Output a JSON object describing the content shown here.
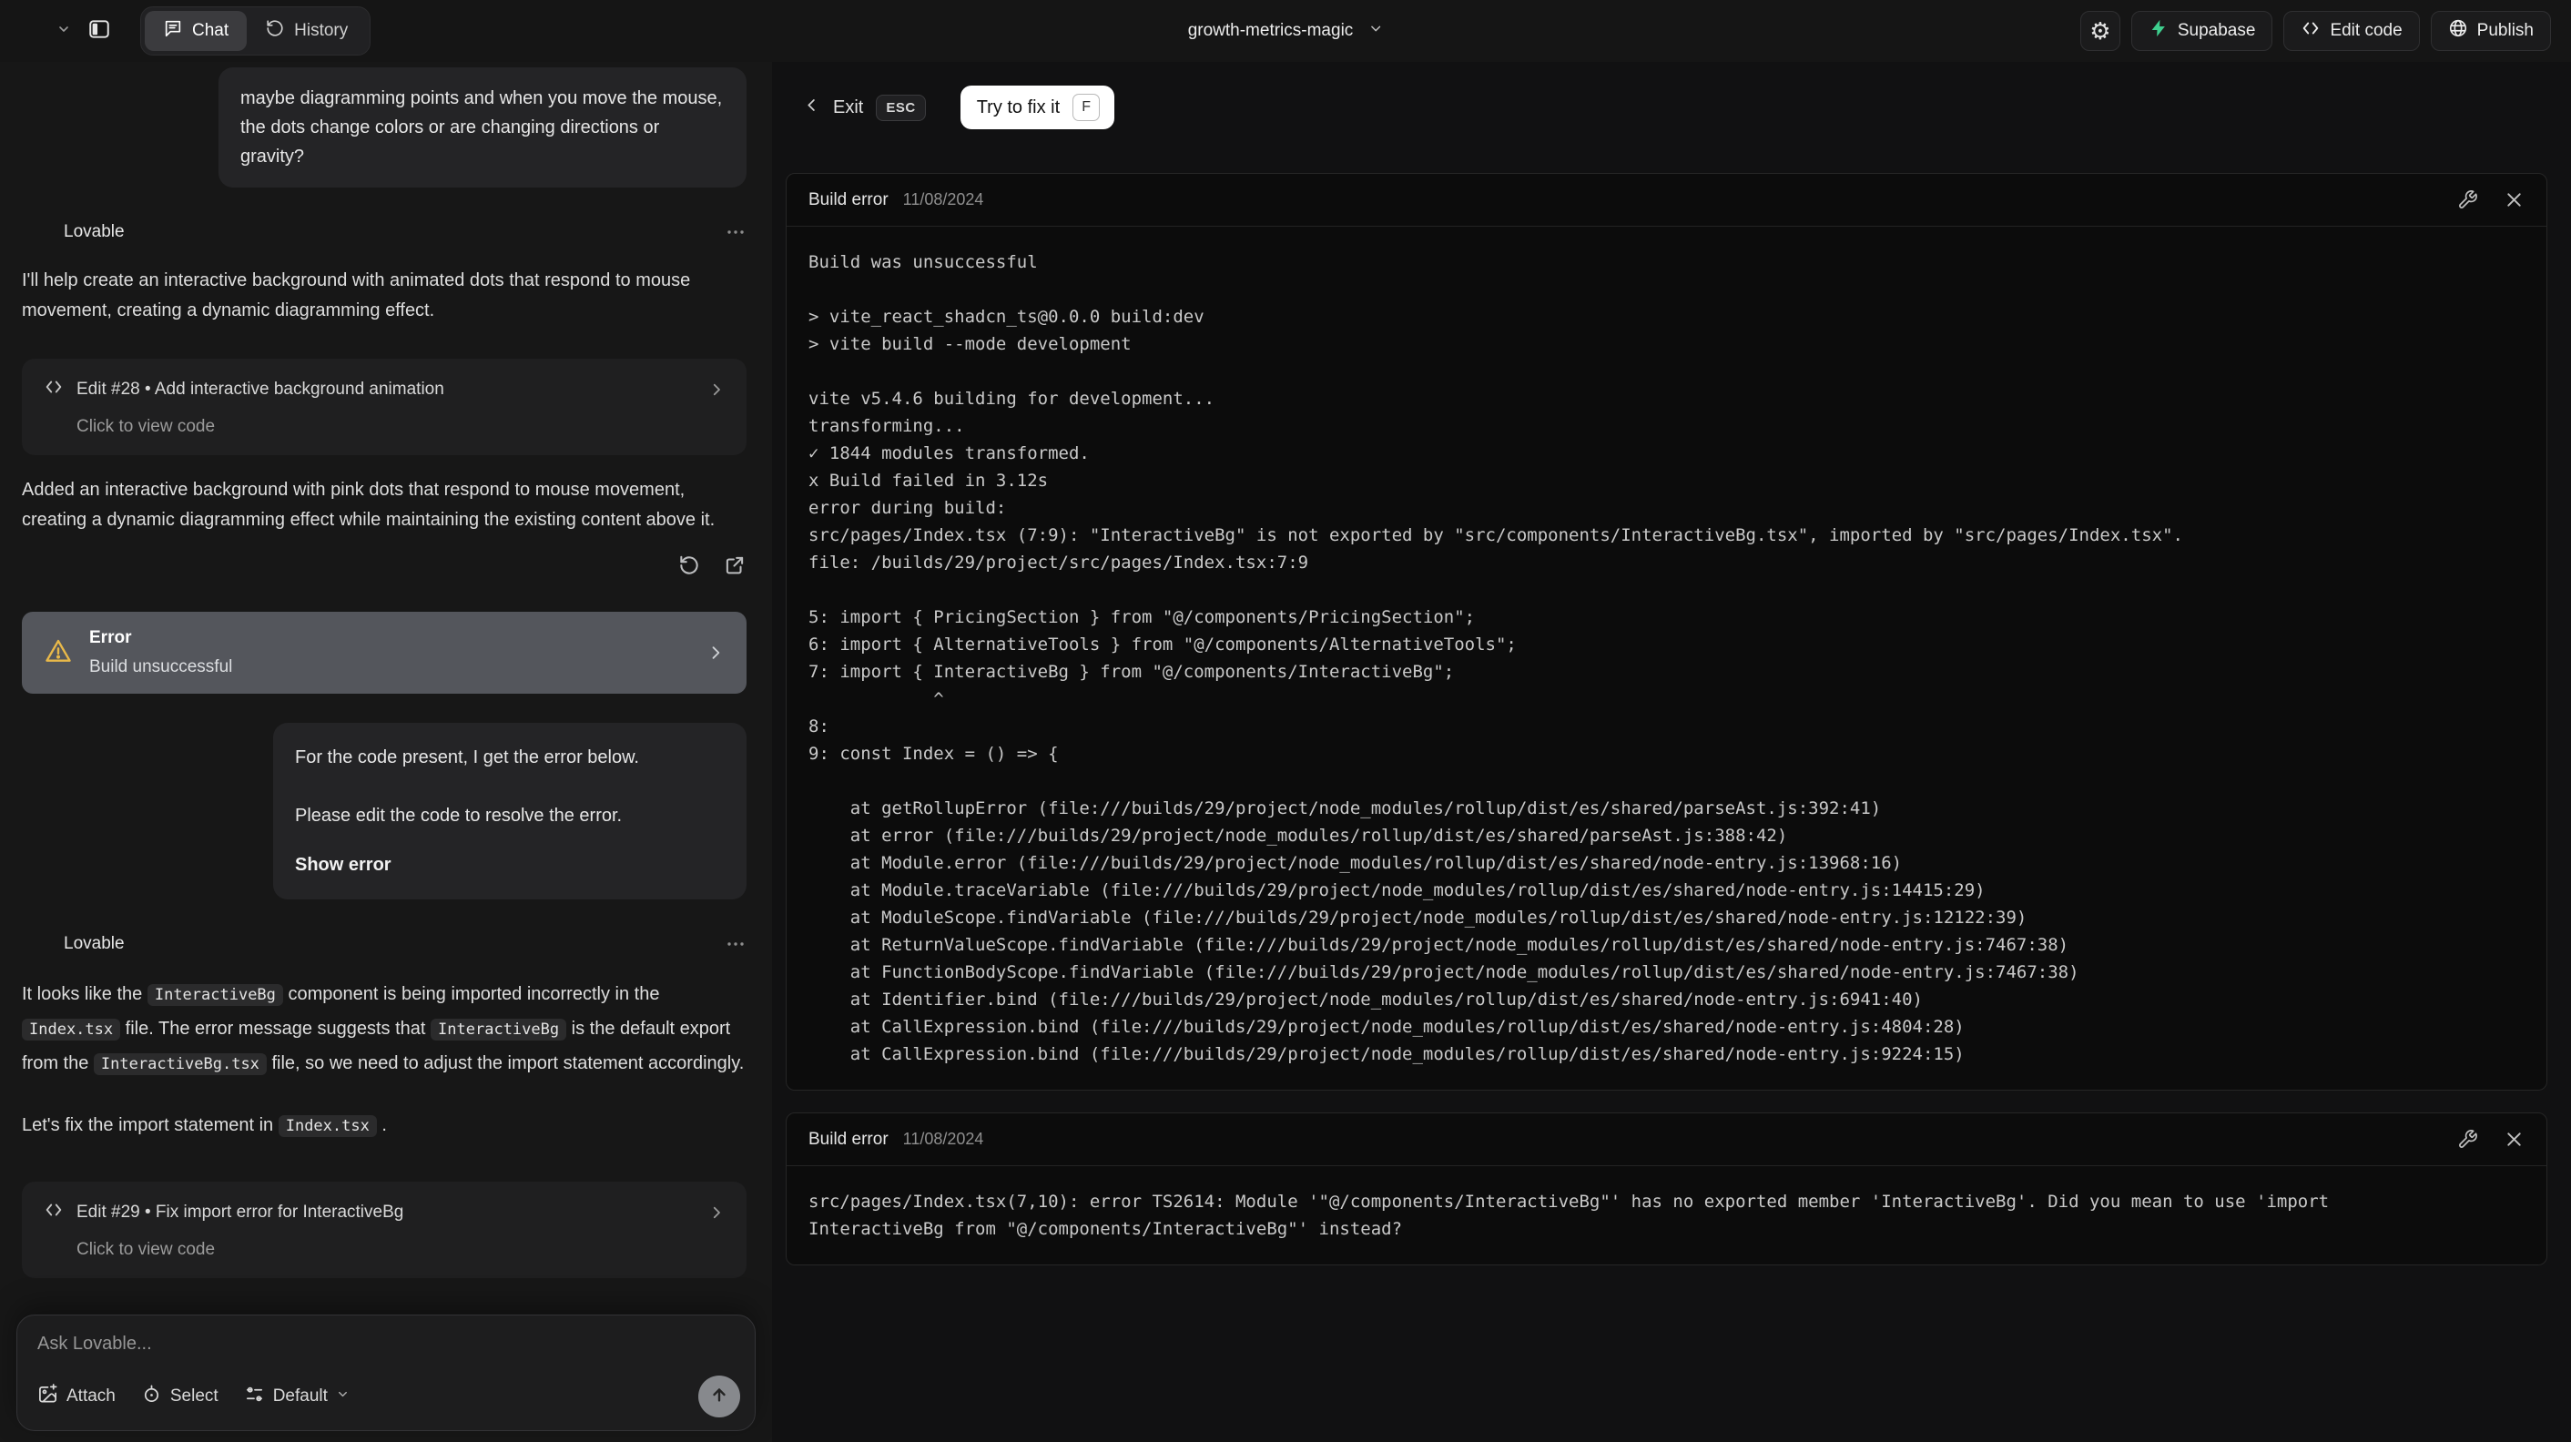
{
  "topbar": {
    "tabs": {
      "chat": "Chat",
      "history": "History"
    },
    "project_name": "growth-metrics-magic",
    "buttons": {
      "supabase": "Supabase",
      "edit_code": "Edit code",
      "publish": "Publish"
    }
  },
  "chat": {
    "assistant_name": "Lovable",
    "user_message_1": "maybe diagramming points and when you move the mouse, the dots change colors or are changing directions or gravity?",
    "reply_1": "I'll help create an interactive background with animated dots that respond to mouse movement, creating a dynamic diagramming effect.",
    "edit_28": {
      "title": "Edit #28 • Add interactive background animation",
      "subtitle": "Click to view code"
    },
    "reply_1b": "Added an interactive background with pink dots that respond to mouse movement, creating a dynamic diagramming effect while maintaining the existing content above it.",
    "error_banner": {
      "title": "Error",
      "subtitle": "Build unsuccessful"
    },
    "user_message_2": {
      "line1": "For the code present, I get the error below.",
      "line2": "Please edit the code to resolve the error.",
      "action": "Show error"
    },
    "reply_2_segments": [
      {
        "t": "text",
        "v": "It looks like the "
      },
      {
        "t": "code",
        "v": "InteractiveBg"
      },
      {
        "t": "text",
        "v": " component is being imported incorrectly in the "
      },
      {
        "t": "code",
        "v": "Index.tsx"
      },
      {
        "t": "text",
        "v": " file. The error message suggests that "
      },
      {
        "t": "code",
        "v": "InteractiveBg"
      },
      {
        "t": "text",
        "v": " is the default export from the "
      },
      {
        "t": "code",
        "v": "InteractiveBg.tsx"
      },
      {
        "t": "text",
        "v": " file, so we need to adjust the import statement accordingly."
      }
    ],
    "reply_2b_segments": [
      {
        "t": "text",
        "v": "Let's fix the import statement in "
      },
      {
        "t": "code",
        "v": "Index.tsx"
      },
      {
        "t": "text",
        "v": " ."
      }
    ],
    "edit_29": {
      "title": "Edit #29 • Fix import error for InteractiveBg",
      "subtitle": "Click to view code"
    },
    "composer": {
      "placeholder": "Ask Lovable...",
      "attach": "Attach",
      "select": "Select",
      "mode": "Default"
    }
  },
  "preview": {
    "exit_label": "Exit",
    "exit_key": "ESC",
    "fix_label": "Try to fix it",
    "fix_key": "F",
    "error_cards": [
      {
        "title": "Build error",
        "date": "11/08/2024",
        "lines": [
          "Build was unsuccessful",
          "",
          "> vite_react_shadcn_ts@0.0.0 build:dev",
          "> vite build --mode development",
          "",
          "vite v5.4.6 building for development...",
          "transforming...",
          "✓ 1844 modules transformed.",
          "x Build failed in 3.12s",
          "error during build:",
          "src/pages/Index.tsx (7:9): \"InteractiveBg\" is not exported by \"src/components/InteractiveBg.tsx\", imported by \"src/pages/Index.tsx\".",
          "file: /builds/29/project/src/pages/Index.tsx:7:9",
          "",
          "5: import { PricingSection } from \"@/components/PricingSection\";",
          "6: import { AlternativeTools } from \"@/components/AlternativeTools\";",
          "7: import { InteractiveBg } from \"@/components/InteractiveBg\";",
          "            ^",
          "8:",
          "9: const Index = () => {",
          "",
          "    at getRollupError (file:///builds/29/project/node_modules/rollup/dist/es/shared/parseAst.js:392:41)",
          "    at error (file:///builds/29/project/node_modules/rollup/dist/es/shared/parseAst.js:388:42)",
          "    at Module.error (file:///builds/29/project/node_modules/rollup/dist/es/shared/node-entry.js:13968:16)",
          "    at Module.traceVariable (file:///builds/29/project/node_modules/rollup/dist/es/shared/node-entry.js:14415:29)",
          "    at ModuleScope.findVariable (file:///builds/29/project/node_modules/rollup/dist/es/shared/node-entry.js:12122:39)",
          "    at ReturnValueScope.findVariable (file:///builds/29/project/node_modules/rollup/dist/es/shared/node-entry.js:7467:38)",
          "    at FunctionBodyScope.findVariable (file:///builds/29/project/node_modules/rollup/dist/es/shared/node-entry.js:7467:38)",
          "    at Identifier.bind (file:///builds/29/project/node_modules/rollup/dist/es/shared/node-entry.js:6941:40)",
          "    at CallExpression.bind (file:///builds/29/project/node_modules/rollup/dist/es/shared/node-entry.js:4804:28)",
          "    at CallExpression.bind (file:///builds/29/project/node_modules/rollup/dist/es/shared/node-entry.js:9224:15)"
        ]
      },
      {
        "title": "Build error",
        "date": "11/08/2024",
        "lines": [
          "src/pages/Index.tsx(7,10): error TS2614: Module '\"@/components/InteractiveBg\"' has no exported member 'InteractiveBg'. Did you mean to use 'import",
          "InteractiveBg from \"@/components/InteractiveBg\"' instead?"
        ]
      }
    ]
  },
  "colors": {
    "supabase_green": "#3ecf8e",
    "warning_amber": "#e9b949",
    "fix_button_bg": "#ffffff"
  }
}
